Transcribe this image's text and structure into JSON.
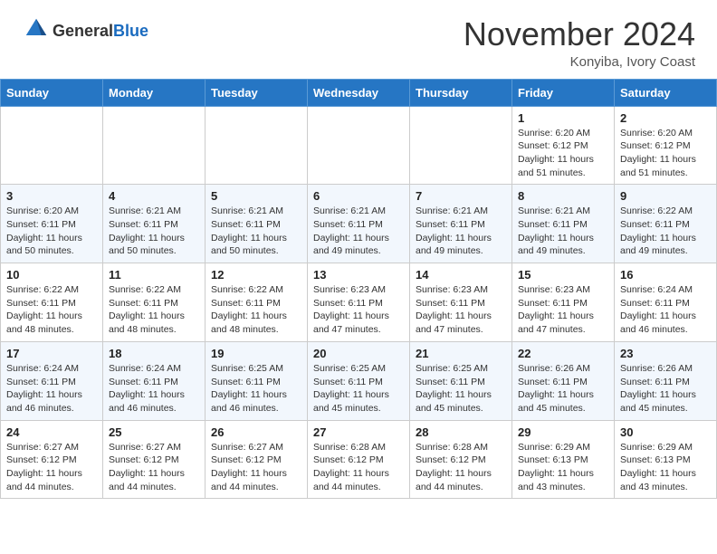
{
  "header": {
    "logo_general": "General",
    "logo_blue": "Blue",
    "month_title": "November 2024",
    "location": "Konyiba, Ivory Coast"
  },
  "weekdays": [
    "Sunday",
    "Monday",
    "Tuesday",
    "Wednesday",
    "Thursday",
    "Friday",
    "Saturday"
  ],
  "rows": [
    [
      {
        "day": "",
        "info": ""
      },
      {
        "day": "",
        "info": ""
      },
      {
        "day": "",
        "info": ""
      },
      {
        "day": "",
        "info": ""
      },
      {
        "day": "",
        "info": ""
      },
      {
        "day": "1",
        "info": "Sunrise: 6:20 AM\nSunset: 6:12 PM\nDaylight: 11 hours\nand 51 minutes."
      },
      {
        "day": "2",
        "info": "Sunrise: 6:20 AM\nSunset: 6:12 PM\nDaylight: 11 hours\nand 51 minutes."
      }
    ],
    [
      {
        "day": "3",
        "info": "Sunrise: 6:20 AM\nSunset: 6:11 PM\nDaylight: 11 hours\nand 50 minutes."
      },
      {
        "day": "4",
        "info": "Sunrise: 6:21 AM\nSunset: 6:11 PM\nDaylight: 11 hours\nand 50 minutes."
      },
      {
        "day": "5",
        "info": "Sunrise: 6:21 AM\nSunset: 6:11 PM\nDaylight: 11 hours\nand 50 minutes."
      },
      {
        "day": "6",
        "info": "Sunrise: 6:21 AM\nSunset: 6:11 PM\nDaylight: 11 hours\nand 49 minutes."
      },
      {
        "day": "7",
        "info": "Sunrise: 6:21 AM\nSunset: 6:11 PM\nDaylight: 11 hours\nand 49 minutes."
      },
      {
        "day": "8",
        "info": "Sunrise: 6:21 AM\nSunset: 6:11 PM\nDaylight: 11 hours\nand 49 minutes."
      },
      {
        "day": "9",
        "info": "Sunrise: 6:22 AM\nSunset: 6:11 PM\nDaylight: 11 hours\nand 49 minutes."
      }
    ],
    [
      {
        "day": "10",
        "info": "Sunrise: 6:22 AM\nSunset: 6:11 PM\nDaylight: 11 hours\nand 48 minutes."
      },
      {
        "day": "11",
        "info": "Sunrise: 6:22 AM\nSunset: 6:11 PM\nDaylight: 11 hours\nand 48 minutes."
      },
      {
        "day": "12",
        "info": "Sunrise: 6:22 AM\nSunset: 6:11 PM\nDaylight: 11 hours\nand 48 minutes."
      },
      {
        "day": "13",
        "info": "Sunrise: 6:23 AM\nSunset: 6:11 PM\nDaylight: 11 hours\nand 47 minutes."
      },
      {
        "day": "14",
        "info": "Sunrise: 6:23 AM\nSunset: 6:11 PM\nDaylight: 11 hours\nand 47 minutes."
      },
      {
        "day": "15",
        "info": "Sunrise: 6:23 AM\nSunset: 6:11 PM\nDaylight: 11 hours\nand 47 minutes."
      },
      {
        "day": "16",
        "info": "Sunrise: 6:24 AM\nSunset: 6:11 PM\nDaylight: 11 hours\nand 46 minutes."
      }
    ],
    [
      {
        "day": "17",
        "info": "Sunrise: 6:24 AM\nSunset: 6:11 PM\nDaylight: 11 hours\nand 46 minutes."
      },
      {
        "day": "18",
        "info": "Sunrise: 6:24 AM\nSunset: 6:11 PM\nDaylight: 11 hours\nand 46 minutes."
      },
      {
        "day": "19",
        "info": "Sunrise: 6:25 AM\nSunset: 6:11 PM\nDaylight: 11 hours\nand 46 minutes."
      },
      {
        "day": "20",
        "info": "Sunrise: 6:25 AM\nSunset: 6:11 PM\nDaylight: 11 hours\nand 45 minutes."
      },
      {
        "day": "21",
        "info": "Sunrise: 6:25 AM\nSunset: 6:11 PM\nDaylight: 11 hours\nand 45 minutes."
      },
      {
        "day": "22",
        "info": "Sunrise: 6:26 AM\nSunset: 6:11 PM\nDaylight: 11 hours\nand 45 minutes."
      },
      {
        "day": "23",
        "info": "Sunrise: 6:26 AM\nSunset: 6:11 PM\nDaylight: 11 hours\nand 45 minutes."
      }
    ],
    [
      {
        "day": "24",
        "info": "Sunrise: 6:27 AM\nSunset: 6:12 PM\nDaylight: 11 hours\nand 44 minutes."
      },
      {
        "day": "25",
        "info": "Sunrise: 6:27 AM\nSunset: 6:12 PM\nDaylight: 11 hours\nand 44 minutes."
      },
      {
        "day": "26",
        "info": "Sunrise: 6:27 AM\nSunset: 6:12 PM\nDaylight: 11 hours\nand 44 minutes."
      },
      {
        "day": "27",
        "info": "Sunrise: 6:28 AM\nSunset: 6:12 PM\nDaylight: 11 hours\nand 44 minutes."
      },
      {
        "day": "28",
        "info": "Sunrise: 6:28 AM\nSunset: 6:12 PM\nDaylight: 11 hours\nand 44 minutes."
      },
      {
        "day": "29",
        "info": "Sunrise: 6:29 AM\nSunset: 6:13 PM\nDaylight: 11 hours\nand 43 minutes."
      },
      {
        "day": "30",
        "info": "Sunrise: 6:29 AM\nSunset: 6:13 PM\nDaylight: 11 hours\nand 43 minutes."
      }
    ]
  ]
}
